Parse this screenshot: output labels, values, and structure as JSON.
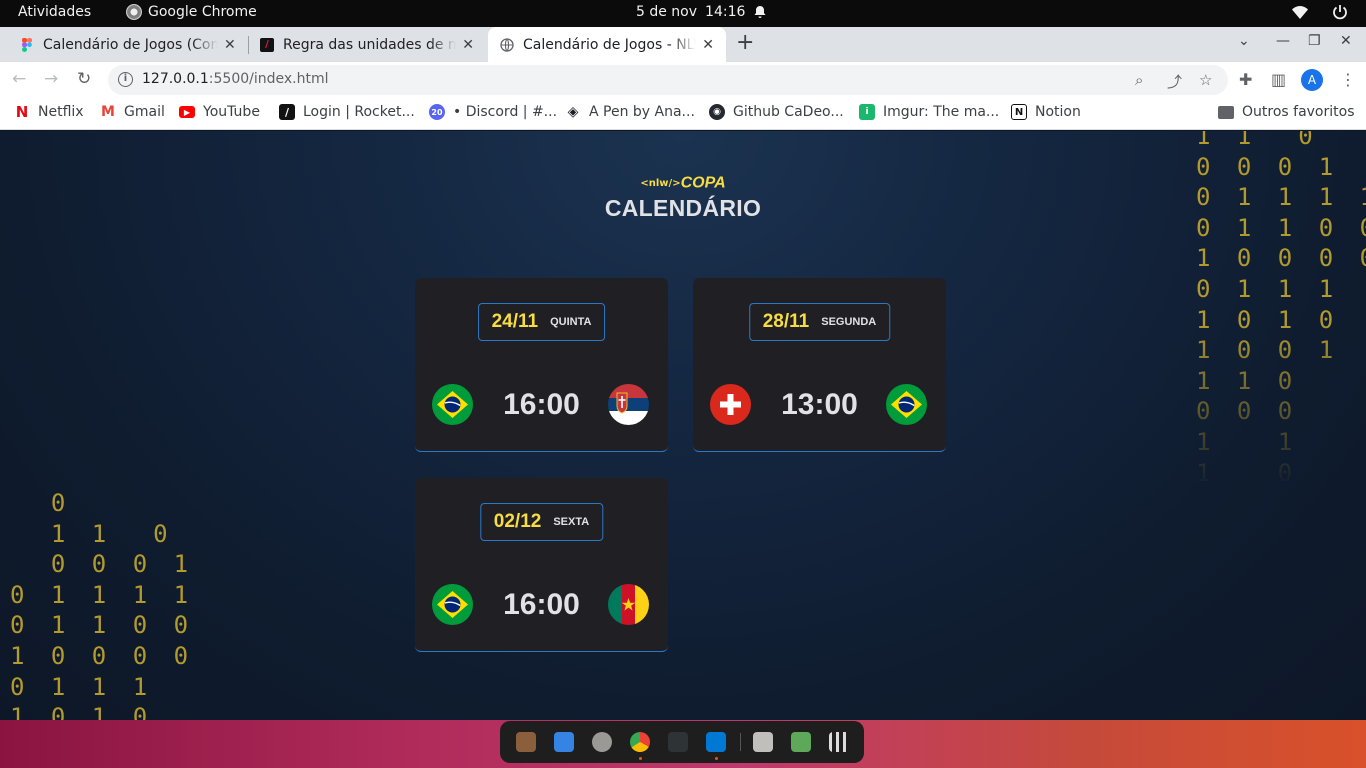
{
  "system_bar": {
    "activities": "Atividades",
    "app_name": "Google Chrome",
    "date": "5 de nov",
    "time": "14:16"
  },
  "tabs": [
    {
      "title": "Calendário de Jogos (Community)",
      "favicon": "figma-icon",
      "active": false
    },
    {
      "title": "Regra das unidades de medida",
      "favicon": "rocketseat-icon",
      "active": false
    },
    {
      "title": "Calendário de Jogos - NLW Copa",
      "favicon": "globe-icon",
      "active": true
    }
  ],
  "address_bar": {
    "host": "127.0.0.1",
    "path": ":5500/index.html",
    "profile_initial": "A"
  },
  "bookmarks": [
    {
      "label": "Netflix",
      "icon": "netflix-icon",
      "color": "#e50914"
    },
    {
      "label": "Gmail",
      "icon": "gmail-icon",
      "color": "#ea4335"
    },
    {
      "label": "YouTube",
      "icon": "youtube-icon",
      "color": "#ff0000"
    },
    {
      "label": "Login | Rocket...",
      "icon": "rocketseat-icon",
      "color": "#121214"
    },
    {
      "label": "• Discord | #...",
      "icon": "discord-icon",
      "color": "#5865f2"
    },
    {
      "label": "A Pen by Ana...",
      "icon": "codepen-icon",
      "color": "#1e1f26"
    },
    {
      "label": "Github CaDeo...",
      "icon": "github-icon",
      "color": "#24292f"
    },
    {
      "label": "Imgur: The ma...",
      "icon": "imgur-icon",
      "color": "#1bb76e"
    },
    {
      "label": "Notion",
      "icon": "notion-icon",
      "color": "#111111"
    }
  ],
  "other_bookmarks": "Outros favoritos",
  "page": {
    "logo_prefix": "<nlw/>",
    "logo_name": "COPA",
    "heading": "CALENDÁRIO",
    "binary_right": "1 1  0\n0 0 0 1\n0 1 1 1 1\n0 1 1 0 0\n1 0 0 0 0\n0 1 1 1\n1 0 1 0\n1 0 0 1\n1 1 0\n0 0 0\n1   1\n1   0",
    "binary_left": "  0\n  1 1  0\n  0 0 0 1\n0 1 1 1 1\n0 1 1 0 0\n1 0 0 0 0\n0 1 1 1\n1 0 1 0",
    "matches": [
      {
        "date": "24/11",
        "weekday": "QUINTA",
        "time": "16:00",
        "home": "brazil",
        "away": "serbia"
      },
      {
        "date": "28/11",
        "weekday": "SEGUNDA",
        "time": "13:00",
        "home": "switzerland",
        "away": "brazil"
      },
      {
        "date": "02/12",
        "weekday": "SEXTA",
        "time": "16:00",
        "home": "brazil",
        "away": "cameroon"
      }
    ]
  },
  "colors": {
    "accent_yellow": "#f7dd43",
    "card_bg": "#202024",
    "card_border": "#2a79c8",
    "text": "#e1e1e6"
  }
}
